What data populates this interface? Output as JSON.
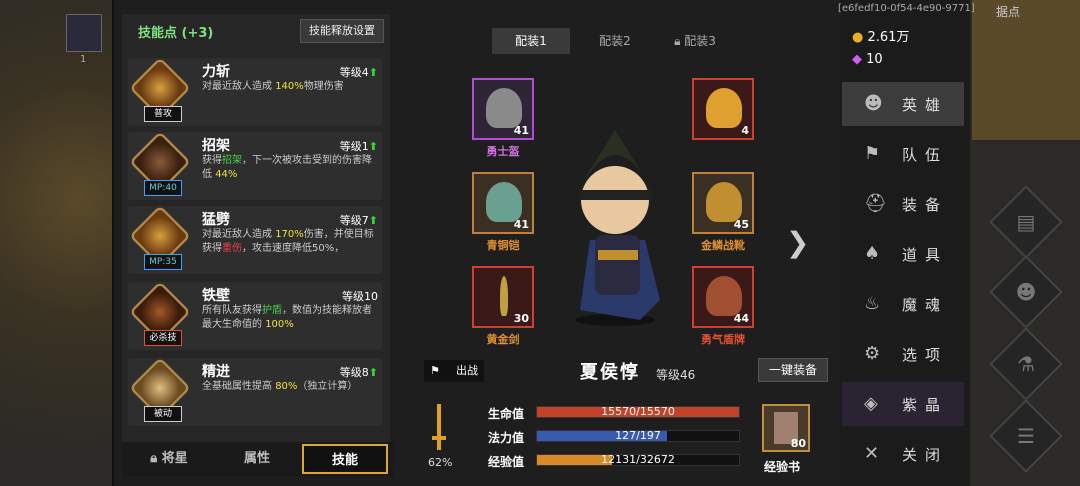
{
  "skill_panel": {
    "points_label": "技能点",
    "points_value": "(+3)",
    "release_settings": "技能释放设置"
  },
  "skills": [
    {
      "name": "力斩",
      "level": "等级4",
      "upgradable": true,
      "tag": "普攻",
      "desc_parts": [
        "对最近敌人造成 ",
        "140%",
        "物理伤害"
      ]
    },
    {
      "name": "招架",
      "level": "等级1",
      "upgradable": true,
      "tag": "MP:40",
      "desc_parts": [
        "获得",
        "招架",
        "，下一次被攻击受到的伤害降低 ",
        "44%"
      ]
    },
    {
      "name": "猛劈",
      "level": "等级7",
      "upgradable": true,
      "tag": "MP:35",
      "desc_parts": [
        "对最近敌人造成 ",
        "170%",
        "伤害，并使目标获得",
        "重伤",
        "，攻击速度降低50%，"
      ]
    },
    {
      "name": "铁壁",
      "level": "等级10",
      "upgradable": false,
      "tag": "必杀技",
      "desc_parts": [
        "所有队友获得",
        "护盾",
        "，数值为技能释放者最大生命值的 ",
        "100%"
      ]
    },
    {
      "name": "精进",
      "level": "等级8",
      "upgradable": true,
      "tag": "被动",
      "desc_parts": [
        "全基础属性提高 ",
        "80%",
        "（独立计算）"
      ]
    }
  ],
  "bottom_tabs": {
    "star": "将星",
    "attr": "属性",
    "skill": "技能"
  },
  "loadouts": [
    "配装1",
    "配装2",
    "配装3"
  ],
  "equipment": [
    {
      "name": "勇士盔",
      "count": "41",
      "color": "#d070e0"
    },
    {
      "name": "青铜铠",
      "count": "41",
      "color": "#e09030"
    },
    {
      "name": "黄金剑",
      "count": "30",
      "color": "#e09030"
    },
    {
      "name": "",
      "count": "4",
      "color": "#e05030"
    },
    {
      "name": "金鳞战靴",
      "count": "45",
      "color": "#e09030"
    },
    {
      "name": "勇气盾牌",
      "count": "44",
      "color": "#e05030"
    }
  ],
  "hero": {
    "name": "夏侯惇",
    "level": "等级46",
    "deploy": "出战",
    "one_click": "一键装备"
  },
  "stats": [
    {
      "label": "生命值",
      "text": "15570/15570",
      "fill": 1.0,
      "color": "#c0432a"
    },
    {
      "label": "法力值",
      "text": "127/197",
      "fill": 0.645,
      "color": "#3a5ab0"
    },
    {
      "label": "经验值",
      "text": "12131/32672",
      "fill": 0.371,
      "color": "#d88a2a"
    }
  ],
  "progress_pct": "62%",
  "exp_book": {
    "label": "经验书",
    "count": "80"
  },
  "uid": "[e6fedf10-0f54-4e90-9771]",
  "currency": {
    "gold": "2.61万",
    "gems": "10"
  },
  "nav": [
    {
      "label": "英雄",
      "icon": "users-icon"
    },
    {
      "label": "队伍",
      "icon": "flag-icon"
    },
    {
      "label": "装备",
      "icon": "helmet-icon"
    },
    {
      "label": "道具",
      "icon": "bag-icon"
    },
    {
      "label": "魔魂",
      "icon": "flame-icon"
    },
    {
      "label": "选项",
      "icon": "gear-icon"
    },
    {
      "label": "紫晶",
      "icon": "crystal-icon"
    },
    {
      "label": "关闭",
      "icon": "close-icon"
    }
  ],
  "outpost_label": "据点",
  "left_count": "1"
}
